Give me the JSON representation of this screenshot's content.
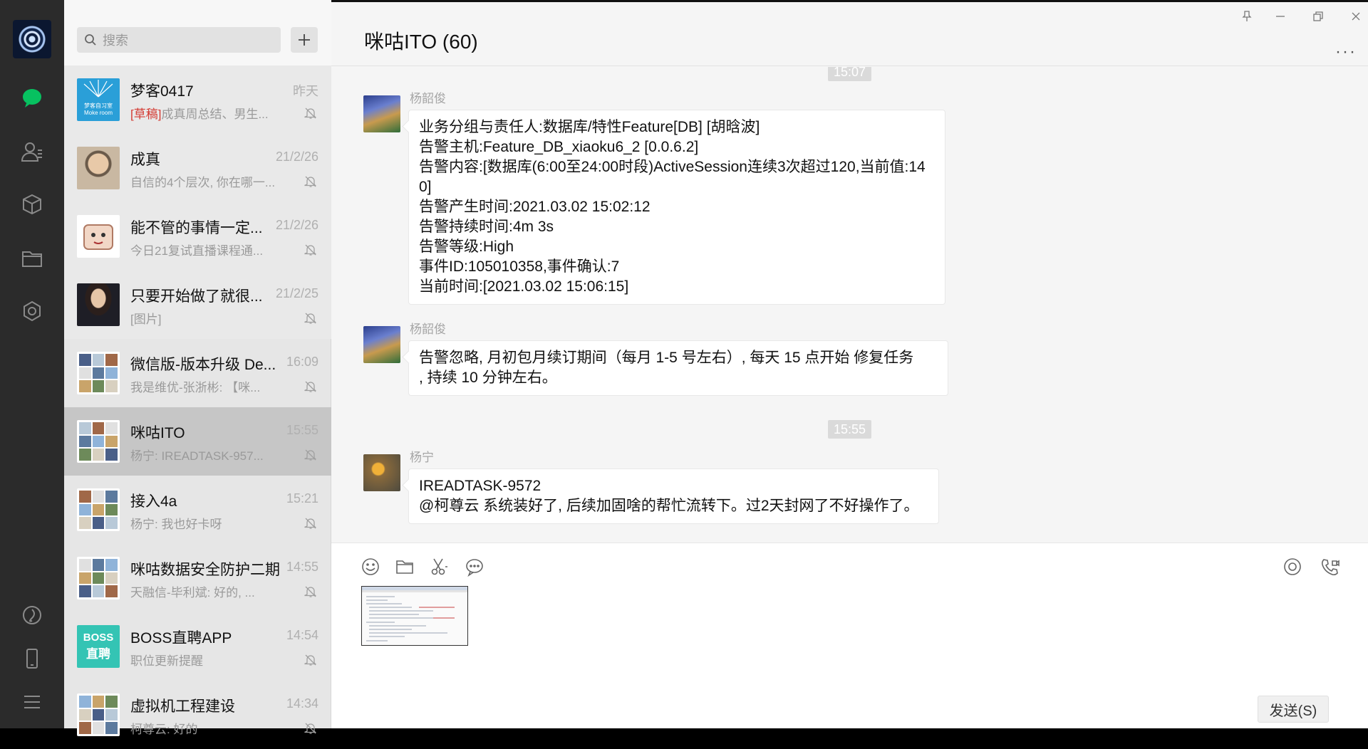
{
  "search": {
    "placeholder": "搜索"
  },
  "chats": [
    {
      "name": "梦客0417",
      "time": "昨天",
      "draft": "[草稿]",
      "preview": "成真周总结、男生...",
      "thumb": "mokeroom"
    },
    {
      "name": "成真",
      "time": "21/2/26",
      "draft": "",
      "preview": "自信的4个层次, 你在哪一...",
      "thumb": "person1"
    },
    {
      "name": "能不管的事情一定...",
      "time": "21/2/26",
      "draft": "",
      "preview": "今日21复试直播课程通...",
      "thumb": "cartoon"
    },
    {
      "name": "只要开始做了就很...",
      "time": "21/2/25",
      "draft": "",
      "preview": "[图片]",
      "thumb": "person2"
    },
    {
      "name": "微信版-版本升级 De...",
      "time": "16:09",
      "draft": "",
      "preview": "我是维优-张浙彬: 【咪...",
      "thumb": "grid"
    },
    {
      "name": "咪咕ITO",
      "time": "15:55",
      "draft": "",
      "preview": "杨宁: IREADTASK-957...",
      "thumb": "grid"
    },
    {
      "name": "接入4a",
      "time": "15:21",
      "draft": "",
      "preview": "杨宁: 我也好卡呀",
      "thumb": "grid"
    },
    {
      "name": "咪咕数据安全防护二期",
      "time": "14:55",
      "draft": "",
      "preview": "天融信-毕利斌: 好的, ...",
      "thumb": "grid"
    },
    {
      "name": "BOSS直聘APP",
      "time": "14:54",
      "draft": "",
      "preview": "职位更新提醒",
      "thumb": "boss"
    },
    {
      "name": "虚拟机工程建设",
      "time": "14:34",
      "draft": "",
      "preview": "柯尊云: 好的",
      "thumb": "grid"
    }
  ],
  "boss_logo": {
    "line1": "BOSS",
    "line2": "直聘"
  },
  "mokeroom_logo": {
    "line1": "梦客自习室",
    "line2": "Moke room"
  },
  "chat": {
    "title": "咪咕ITO (60)",
    "timestamp1": "15:07",
    "timestamp2": "15:55",
    "messages": [
      {
        "sender": "杨韶俊",
        "lines": [
          "业务分组与责任人:数据库/特性Feature[DB] [胡晗波]",
          "告警主机:Feature_DB_xiaoku6_2 [0.0.6.2]",
          "告警内容:[数据库(6:00至24:00时段)ActiveSession连续3次超过120,当前值:14",
          "0]",
          "告警产生时间:2021.03.02 15:02:12",
          "告警持续时间:4m 3s",
          "告警等级:High",
          "事件ID:105010358,事件确认:7",
          "当前时间:[2021.03.02 15:06:15]"
        ]
      },
      {
        "sender": "杨韶俊",
        "lines": [
          "告警忽略, 月初包月续订期间（每月 1-5 号左右）, 每天 15 点开始 修复任务",
          ", 持续 10 分钟左右。"
        ]
      },
      {
        "sender": "杨宁",
        "lines": [
          "IREADTASK-9572",
          "@柯尊云 系统装好了, 后续加固啥的帮忙流转下。过2天封网了不好操作了。"
        ]
      }
    ]
  },
  "input": {
    "send_label": "发送(S)"
  },
  "colors": {
    "accent": "#07c160",
    "navbar": "#2b2b2b",
    "list_bg": "#e6e6e6",
    "active_item": "#c6c6c6"
  }
}
